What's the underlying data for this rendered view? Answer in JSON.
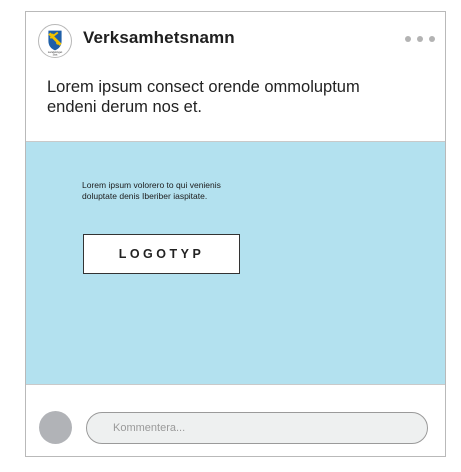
{
  "post": {
    "org_name": "Verksamhetsnamn",
    "logo_text_line1": "Landstinget",
    "logo_text_line2": "Stat",
    "more_icon": "more-horizontal-icon",
    "text": "Lorem ipsum consect orende ommoluptum endeni derum nos et."
  },
  "media": {
    "background_color": "#b3e1ef",
    "copy": "Lorem ipsum volorero to qui venienis doluptate denis Iberiber iaspitate.",
    "logo_label": "LOGOTYP"
  },
  "comment": {
    "placeholder": "Kommentera..."
  }
}
